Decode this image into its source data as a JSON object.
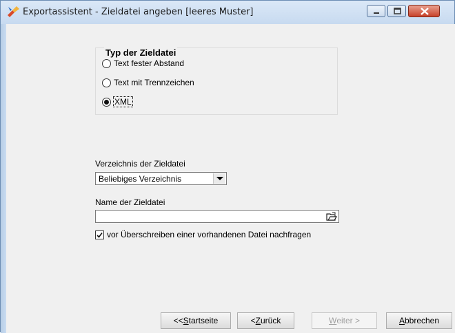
{
  "window": {
    "title": "Exportassistent - Zieldatei angeben [leeres Muster]"
  },
  "group": {
    "title": "Typ der Zieldatei",
    "options": [
      {
        "label": "Text fester Abstand",
        "selected": false
      },
      {
        "label": "Text mit Trennzeichen",
        "selected": false
      },
      {
        "label": "XML",
        "selected": true
      }
    ]
  },
  "directory": {
    "label": "Verzeichnis der Zieldatei",
    "selected": "Beliebiges Verzeichnis"
  },
  "filename": {
    "label": "Name der Zieldatei",
    "value": ""
  },
  "overwrite": {
    "label": "vor Überschreiben einer vorhandenen Datei nachfragen",
    "checked": true
  },
  "buttons": {
    "start_prefix": "<< ",
    "start_mnemonic": "S",
    "start_rest": "tartseite",
    "back_prefix": "< ",
    "back_mnemonic": "Z",
    "back_rest": "urück",
    "next_mnemonic": "W",
    "next_rest": "eiter >",
    "cancel_mnemonic": "A",
    "cancel_rest": "bbrechen"
  }
}
